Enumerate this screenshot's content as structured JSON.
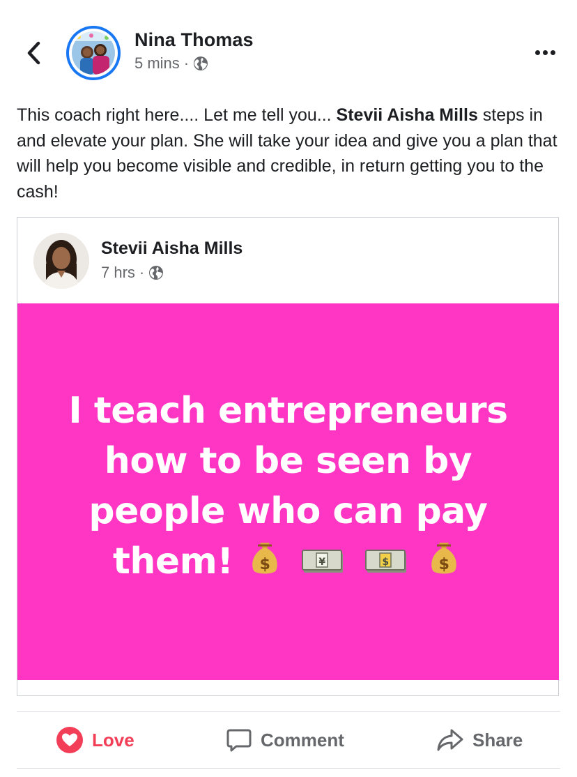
{
  "header": {
    "author_name": "Nina Thomas",
    "time": "5 mins",
    "separator": "·",
    "privacy_icon": "globe-icon",
    "back_icon": "chevron-left-icon",
    "more_icon": "ellipsis-icon"
  },
  "post": {
    "text_before": "This coach right here.... Let me tell you... ",
    "mention": "Stevii Aisha Mills",
    "text_after": " steps in and elevate your plan. She will take your idea and give you a plan that will help you become visible and credible, in return getting you to the cash!"
  },
  "shared": {
    "author_name": "Stevii Aisha Mills",
    "time": "7 hrs",
    "separator": "·",
    "privacy_icon": "globe-icon",
    "image_text": "I teach entrepreneurs how to be seen by people who can pay them!",
    "image_bg": "#ff36c4",
    "emojis": [
      "money-bag-icon",
      "yen-banknote-icon",
      "dollar-banknote-icon",
      "money-bag-icon"
    ]
  },
  "actions": {
    "love_label": "Love",
    "comment_label": "Comment",
    "share_label": "Share",
    "love_color": "#f33e58",
    "muted_color": "#65676b"
  }
}
